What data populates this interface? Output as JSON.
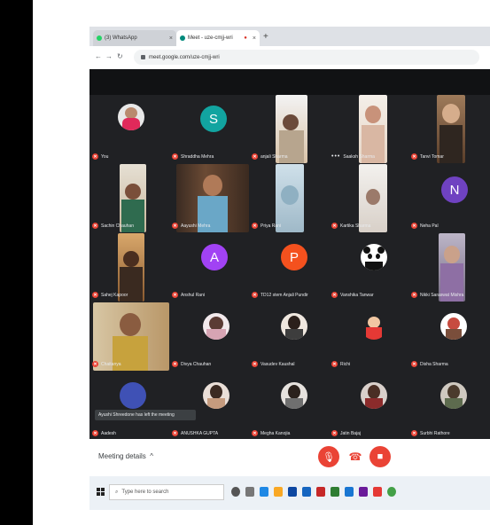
{
  "browser": {
    "tabs": [
      {
        "label": "(3) WhatsApp",
        "color": "#25d366"
      },
      {
        "label": "Meet - uze-cmjj-wri",
        "color": "#00897b"
      }
    ],
    "url": "meet.google.com/uze-cmjj-wri"
  },
  "participants": [
    {
      "name": "You"
    },
    {
      "name": "Shraddha Mehra",
      "initial": "S"
    },
    {
      "name": "anjali Sharma"
    },
    {
      "name": "Saaksh Sharma"
    },
    {
      "name": "Tanvi Tomar"
    },
    {
      "name": "Sachin Chauhan"
    },
    {
      "name": "Aayushi Mehra"
    },
    {
      "name": "Priya Rani"
    },
    {
      "name": "Kartika Sharma"
    },
    {
      "name": "Neha Pal",
      "initial": "N"
    },
    {
      "name": "Sahej Kapoor"
    },
    {
      "name": "Anshul Rani",
      "initial": "A"
    },
    {
      "name": "TD12 stem Anjali Pundir",
      "initial": "P"
    },
    {
      "name": "Vanshika Tanwar"
    },
    {
      "name": "Nikki Saraswat Mishra"
    },
    {
      "name": "Chaitanya"
    },
    {
      "name": "Divya Chauhan"
    },
    {
      "name": "Vasudev Kaushal"
    },
    {
      "name": "Richi"
    },
    {
      "name": "Disha Sharma"
    },
    {
      "name": "Aadesh"
    },
    {
      "name": "ANUSHKA GUPTA"
    },
    {
      "name": "Megha Kanojia"
    },
    {
      "name": "Jatin Bajaj"
    },
    {
      "name": "Surbhi Rathore"
    }
  ],
  "toast": "Ayushi Shreedone has left the meeting",
  "controls": {
    "meeting_details": "Meeting details"
  },
  "taskbar": {
    "search_placeholder": "Type here to search"
  }
}
